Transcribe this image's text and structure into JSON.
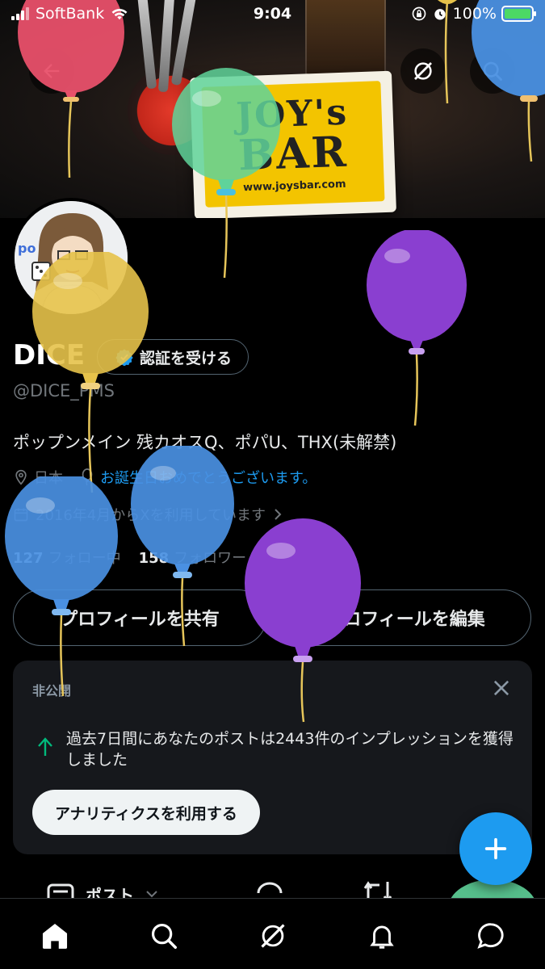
{
  "status_bar": {
    "carrier": "SoftBank",
    "time": "9:04",
    "battery": "100%"
  },
  "banner": {
    "coaster_line1": "JOY's",
    "coaster_line2": "BAR",
    "coaster_url": "www.joysbar.com"
  },
  "profile": {
    "display_name": "DICE",
    "verify_label": "認証を受ける",
    "handle": "@DICE_PMS",
    "bio": "ポップンメイン 残カオスQ、ポパU、THX(未解禁)",
    "location": "日本",
    "birthday": "お誕生日おめでとうございます。",
    "joined": "2016年4月からXを利用しています",
    "following_count": "127",
    "following_label": "フォロー中",
    "followers_count": "158",
    "followers_label": "フォロワー"
  },
  "actions": {
    "share_label": "プロフィールを共有",
    "edit_label": "プロフィールを編集"
  },
  "analytics_card": {
    "private_label": "非公開",
    "message": "過去7日間にあなたのポストは2443件のインプレッションを獲得しました",
    "button_label": "アナリティクスを利用する"
  },
  "tabs": {
    "posts_label": "ポスト"
  },
  "colors": {
    "accent": "#1d9bf0",
    "background": "#000000",
    "balloon_red": "#e8506a",
    "balloon_green": "#5fd39a",
    "balloon_yellow": "#e6c24a",
    "balloon_purple": "#8a3fd0",
    "balloon_blue": "#4a90e2"
  },
  "icons": {
    "back": "back-arrow-icon",
    "grok": "grok-icon",
    "search": "search-icon",
    "verified": "verified-badge-icon",
    "location": "location-pin-icon",
    "birthday": "balloon-icon",
    "calendar": "calendar-icon",
    "close": "close-icon",
    "trend": "arrow-up-icon",
    "compose": "plus-icon",
    "nav": [
      "home-icon",
      "search-icon",
      "grok-icon",
      "bell-icon",
      "messages-icon"
    ]
  }
}
